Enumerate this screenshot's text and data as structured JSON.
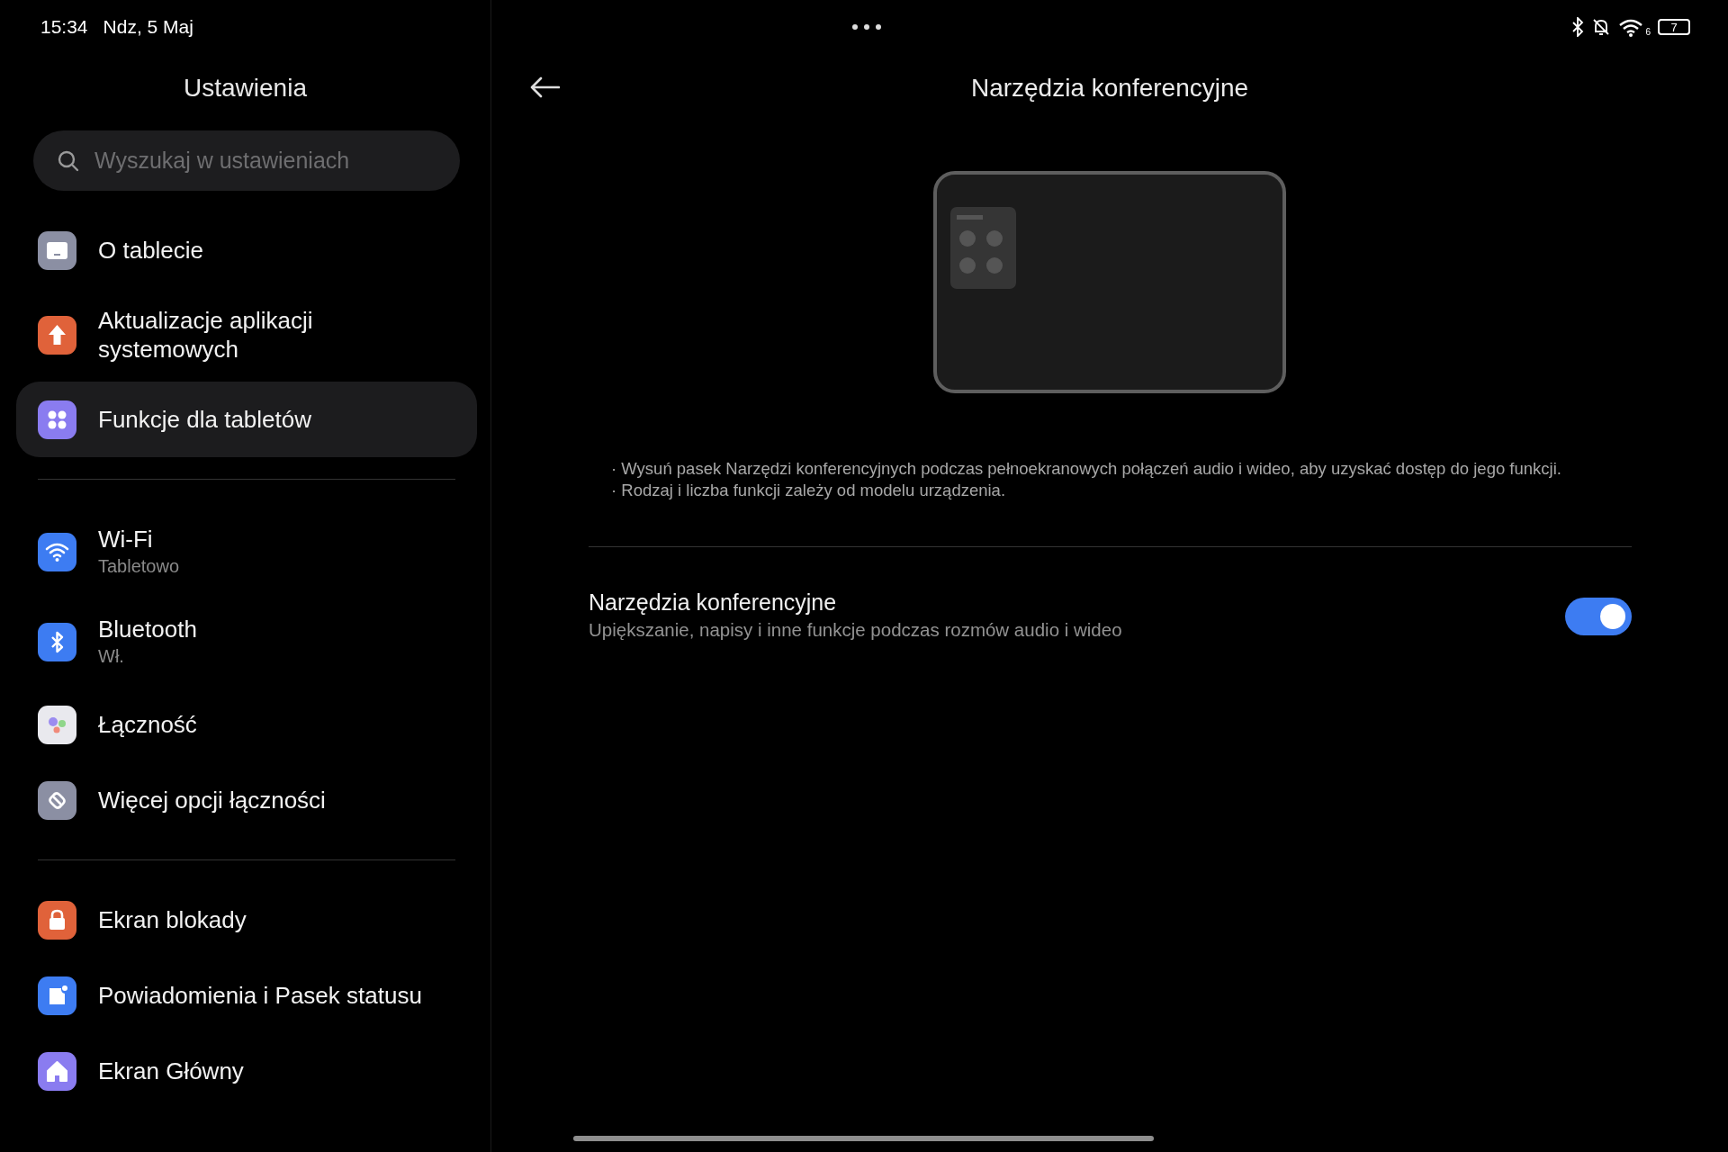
{
  "status_bar": {
    "time": "15:34",
    "date": "Ndz, 5 Maj",
    "wifi_badge": "6",
    "battery": "7"
  },
  "sidebar": {
    "title": "Ustawienia",
    "search": {
      "placeholder": "Wyszukaj w ustawieniach"
    },
    "groups": [
      [
        {
          "label": "O tablecie",
          "selected": false
        },
        {
          "label": "Aktualizacje aplikacji systemowych",
          "selected": false
        },
        {
          "label": "Funkcje dla tabletów",
          "selected": true
        }
      ],
      [
        {
          "label": "Wi-Fi",
          "subtitle": "Tabletowo",
          "selected": false
        },
        {
          "label": "Bluetooth",
          "subtitle": "Wł.",
          "selected": false
        },
        {
          "label": "Łączność",
          "selected": false
        },
        {
          "label": "Więcej opcji łączności",
          "selected": false
        }
      ],
      [
        {
          "label": "Ekran blokady",
          "selected": false
        },
        {
          "label": "Powiadomienia i Pasek statusu",
          "selected": false
        },
        {
          "label": "Ekran Główny",
          "selected": false
        }
      ]
    ]
  },
  "detail": {
    "title": "Narzędzia konferencyjne",
    "notes": [
      "· Wysuń pasek Narzędzi konferencyjnych podczas pełnoekranowych połączeń audio i wideo, aby uzyskać dostęp do jego funkcji.",
      "· Rodzaj i liczba funkcji zależy od modelu urządzenia."
    ],
    "setting": {
      "title": "Narzędzia konferencyjne",
      "subtitle": "Upiększanie, napisy i inne funkcje podczas rozmów audio i wideo",
      "on": true
    }
  }
}
